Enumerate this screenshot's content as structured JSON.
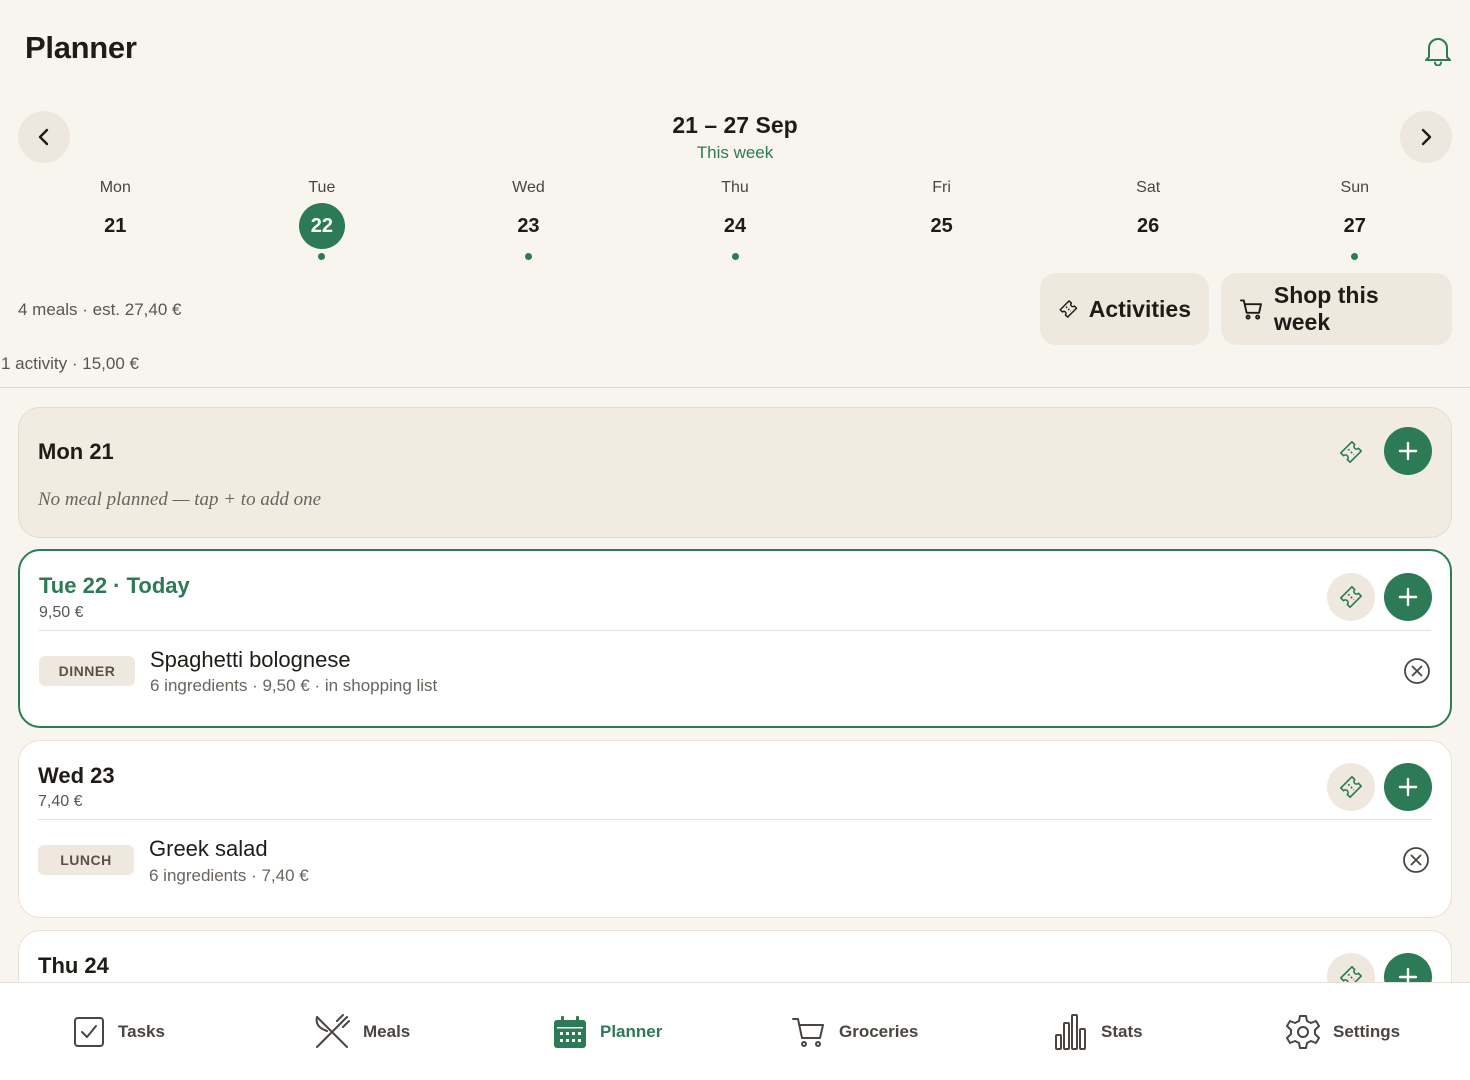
{
  "header": {
    "title": "Planner",
    "bell_icon": "bell-icon"
  },
  "week": {
    "range": "21 – 27 Sep",
    "subtitle": "This week"
  },
  "days": [
    {
      "name": "Mon",
      "num": "21",
      "selected": false,
      "has_dot": false
    },
    {
      "name": "Tue",
      "num": "22",
      "selected": true,
      "has_dot": true
    },
    {
      "name": "Wed",
      "num": "23",
      "selected": false,
      "has_dot": true
    },
    {
      "name": "Thu",
      "num": "24",
      "selected": false,
      "has_dot": true
    },
    {
      "name": "Fri",
      "num": "25",
      "selected": false,
      "has_dot": false
    },
    {
      "name": "Sat",
      "num": "26",
      "selected": false,
      "has_dot": false
    },
    {
      "name": "Sun",
      "num": "27",
      "selected": false,
      "has_dot": true
    }
  ],
  "summary": {
    "meals": "4 meals · est. 27,40 €",
    "activity": "1 activity · 15,00 €"
  },
  "actions": {
    "activities_label": "Activities",
    "shop_label": "Shop this week"
  },
  "cards": {
    "mon": {
      "title": "Mon 21",
      "empty_text": "No meal planned — tap + to add one"
    },
    "tue": {
      "title": "Tue 22  · Today",
      "cost": "9,50 €",
      "meal": {
        "tag": "DINNER",
        "name": "Spaghetti bolognese",
        "meta": "6 ingredients · 9,50 € · in shopping list"
      }
    },
    "wed": {
      "title": "Wed 23",
      "cost": "7,40 €",
      "meal": {
        "tag": "LUNCH",
        "name": "Greek salad",
        "meta": "6 ingredients · 7,40 €"
      }
    },
    "thu": {
      "title": "Thu 24"
    }
  },
  "bottom_nav": [
    {
      "label": "Tasks",
      "icon": "checkbox-icon",
      "active": false
    },
    {
      "label": "Meals",
      "icon": "fork-knife-icon",
      "active": false
    },
    {
      "label": "Planner",
      "icon": "calendar-icon",
      "active": true
    },
    {
      "label": "Groceries",
      "icon": "cart-icon",
      "active": false
    },
    {
      "label": "Stats",
      "icon": "bar-chart-icon",
      "active": false
    },
    {
      "label": "Settings",
      "icon": "gear-icon",
      "active": false
    }
  ],
  "colors": {
    "accent": "#2c7a56",
    "background": "#f8f5ef",
    "chip": "#efe8de"
  }
}
